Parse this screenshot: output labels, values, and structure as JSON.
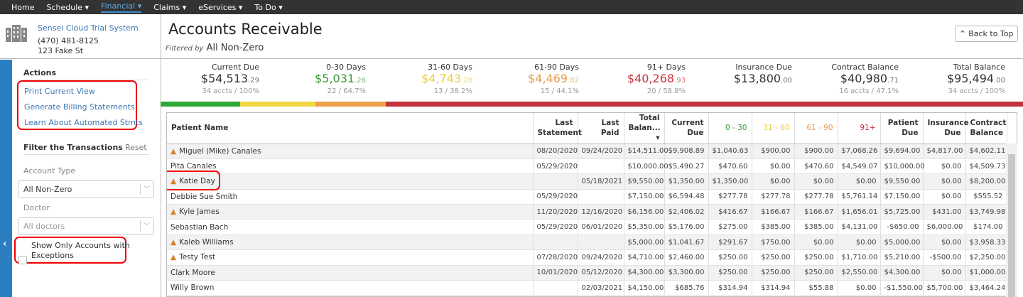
{
  "nav": {
    "items": [
      "Home",
      "Schedule ▾",
      "Financial ▾",
      "Claims ▾",
      "eServices ▾",
      "To Do ▾"
    ],
    "active": 2
  },
  "org": {
    "name": "Sensei Cloud Trial System",
    "phone": "(470) 481-8125",
    "address": "123 Fake St"
  },
  "sidebar": {
    "actions_title": "Actions",
    "actions": [
      "Print Current View",
      "Generate Billing Statements",
      "Learn About Automated Stmts"
    ],
    "filter_title": "Filter the Transactions",
    "reset": "Reset",
    "account_type_label": "Account Type",
    "account_type_value": "All Non-Zero",
    "doctor_label": "Doctor",
    "doctor_placeholder": "All doctors",
    "exceptions_label": "Show Only Accounts with",
    "exceptions_label2": "Exceptions",
    "collapse": "‹"
  },
  "header": {
    "title": "Accounts Receivable",
    "filtered_by": "Filtered by",
    "filter_value": "All Non-Zero",
    "back_to_top": "Back to Top",
    "back_icon": "⌃"
  },
  "summary": [
    {
      "label": "Current Due",
      "whole": "$54,513",
      "cents": ".29",
      "sub": "34 accts / 100%",
      "color": "#333333"
    },
    {
      "label": "0-30 Days",
      "whole": "$5,031",
      "cents": ".26",
      "sub": "22 / 64.7%",
      "color": "#3a9a3a"
    },
    {
      "label": "31-60 Days",
      "whole": "$4,743",
      "cents": ".28",
      "sub": "13 / 38.2%",
      "color": "#e8cf3c"
    },
    {
      "label": "61-90 Days",
      "whole": "$4,469",
      "cents": ".82",
      "sub": "15 / 44.1%",
      "color": "#eb9a4e"
    },
    {
      "label": "91+ Days",
      "whole": "$40,268",
      "cents": ".93",
      "sub": "20 / 58.8%",
      "color": "#c9323b"
    },
    {
      "label": "Insurance Due",
      "whole": "$13,800",
      "cents": ".00",
      "sub": "",
      "color": "#333333"
    },
    {
      "label": "Contract Balance",
      "whole": "$40,980",
      "cents": ".71",
      "sub": "16 accts / 47.1%",
      "color": "#333333"
    },
    {
      "label": "Total Balance",
      "whole": "$95,494",
      "cents": ".00",
      "sub": "34 accts / 100%",
      "color": "#333333"
    }
  ],
  "aging_bar": [
    {
      "color": "#2ea836",
      "share": 112
    },
    {
      "color": "#f0d842",
      "share": 106
    },
    {
      "color": "#ef9f4c",
      "share": 99
    },
    {
      "color": "#c1323a",
      "share": 897
    }
  ],
  "table": {
    "columns": [
      "Patient Name",
      "Last Statement",
      "Last Paid",
      "Total Balan... ▾",
      "Current Due",
      "0 - 30",
      "31 - 60",
      "61 - 90",
      "91+",
      "Patient Due",
      "Insurance Due",
      "Contract Balance"
    ],
    "column_colors": {
      "5": "#3a9a3a",
      "6": "#e8cf3c",
      "7": "#eb9a4e",
      "8": "#c9323b"
    },
    "rows": [
      {
        "warn": true,
        "cells": [
          "Miguel (Mike) Canales",
          "08/20/2020",
          "09/24/2020",
          "$14,511.00",
          "$9,908.89",
          "$1,040.63",
          "$900.00",
          "$900.00",
          "$7,068.26",
          "$9,694.00",
          "$4,817.00",
          "$4,602.11"
        ]
      },
      {
        "warn": false,
        "cells": [
          "Pita Canales",
          "05/29/2020",
          "",
          "$10,000.00",
          "$5,490.27",
          "$470.60",
          "$0.00",
          "$470.60",
          "$4,549.07",
          "$10,000.00",
          "$0.00",
          "$4,509.73"
        ]
      },
      {
        "warn": true,
        "cells": [
          "Katie Day",
          "",
          "05/18/2021",
          "$9,550.00",
          "$1,350.00",
          "$1,350.00",
          "$0.00",
          "$0.00",
          "$0.00",
          "$9,550.00",
          "$0.00",
          "$8,200.00"
        ]
      },
      {
        "warn": false,
        "cells": [
          "Debbie Sue Smith",
          "05/29/2020",
          "",
          "$7,150.00",
          "$6,594.48",
          "$277.78",
          "$277.78",
          "$277.78",
          "$5,761.14",
          "$7,150.00",
          "$0.00",
          "$555.52"
        ]
      },
      {
        "warn": true,
        "cells": [
          "Kyle James",
          "11/20/2020",
          "12/16/2020",
          "$6,156.00",
          "$2,406.02",
          "$416.67",
          "$166.67",
          "$166.67",
          "$1,656.01",
          "$5,725.00",
          "$431.00",
          "$3,749.98"
        ]
      },
      {
        "warn": false,
        "cells": [
          "Sebastian Bach",
          "05/29/2020",
          "06/01/2020",
          "$5,350.00",
          "$5,176.00",
          "$275.00",
          "$385.00",
          "$385.00",
          "$4,131.00",
          "-$650.00",
          "$6,000.00",
          "$174.00"
        ]
      },
      {
        "warn": true,
        "cells": [
          "Kaleb Williams",
          "",
          "",
          "$5,000.00",
          "$1,041.67",
          "$291.67",
          "$750.00",
          "$0.00",
          "$0.00",
          "$5,000.00",
          "$0.00",
          "$3,958.33"
        ]
      },
      {
        "warn": true,
        "cells": [
          "Testy Test",
          "07/28/2020",
          "09/24/2020",
          "$4,710.00",
          "$2,460.00",
          "$250.00",
          "$250.00",
          "$250.00",
          "$1,710.00",
          "$5,210.00",
          "-$500.00",
          "$2,250.00"
        ]
      },
      {
        "warn": false,
        "cells": [
          "Clark Moore",
          "10/01/2020",
          "05/12/2020",
          "$4,300.00",
          "$3,300.00",
          "$250.00",
          "$250.00",
          "$250.00",
          "$2,550.00",
          "$4,300.00",
          "$0.00",
          "$1,000.00"
        ]
      },
      {
        "warn": false,
        "cells": [
          "Willy Brown",
          "",
          "02/03/2021",
          "$4,150.00",
          "$685.76",
          "$314.94",
          "$314.94",
          "$55.88",
          "$0.00",
          "-$1,550.00",
          "$5,700.00",
          "$3,464.24"
        ]
      }
    ]
  }
}
